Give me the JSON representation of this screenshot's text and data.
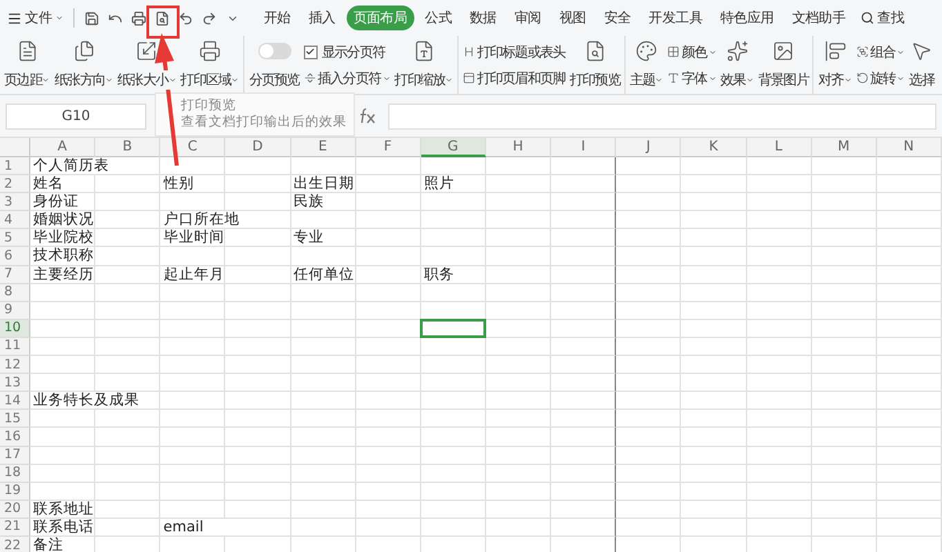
{
  "menu": {
    "file_label": "文件",
    "tabs": [
      {
        "label": "开始",
        "selected": false
      },
      {
        "label": "插入",
        "selected": false
      },
      {
        "label": "页面布局",
        "selected": true
      },
      {
        "label": "公式",
        "selected": false
      },
      {
        "label": "数据",
        "selected": false
      },
      {
        "label": "审阅",
        "selected": false
      },
      {
        "label": "视图",
        "selected": false
      },
      {
        "label": "安全",
        "selected": false
      },
      {
        "label": "开发工具",
        "selected": false
      },
      {
        "label": "特色应用",
        "selected": false
      },
      {
        "label": "文档助手",
        "selected": false
      }
    ],
    "search_label": "查找"
  },
  "ribbon": [
    [
      {
        "kind": "large",
        "label": "页边距",
        "dropdown": true
      },
      {
        "kind": "large",
        "label": "纸张方向",
        "dropdown": true
      },
      {
        "kind": "large",
        "label": "纸张大小",
        "dropdown": true
      },
      {
        "kind": "large",
        "label": "打印区域",
        "dropdown": true
      }
    ],
    [
      {
        "kind": "toggle",
        "label": "分页预览",
        "on": false
      },
      {
        "kind": "stack",
        "items": [
          {
            "kind": "check",
            "label": "显示分页符",
            "checked": true
          },
          {
            "kind": "small",
            "label": "插入分页符",
            "dropdown": true
          }
        ]
      },
      {
        "kind": "large",
        "label": "打印缩放",
        "dropdown": true
      }
    ],
    [
      {
        "kind": "stack",
        "items": [
          {
            "kind": "small",
            "label": "打印标题或表头",
            "dropdown": false
          },
          {
            "kind": "small",
            "label": "打印页眉和页脚",
            "dropdown": false
          }
        ]
      },
      {
        "kind": "large",
        "label": "打印预览",
        "dropdown": false
      }
    ],
    [
      {
        "kind": "large",
        "label": "主题",
        "dropdown": true
      },
      {
        "kind": "stack",
        "items": [
          {
            "kind": "small",
            "label": "颜色",
            "dropdown": true
          },
          {
            "kind": "small",
            "label": "字体",
            "dropdown": true
          }
        ]
      },
      {
        "kind": "large",
        "label": "效果",
        "dropdown": true
      },
      {
        "kind": "large",
        "label": "背景图片",
        "dropdown": false
      }
    ],
    [
      {
        "kind": "large",
        "label": "对齐",
        "dropdown": true
      },
      {
        "kind": "stack",
        "items": [
          {
            "kind": "small",
            "label": "组合",
            "dropdown": true
          },
          {
            "kind": "small",
            "label": "旋转",
            "dropdown": true
          }
        ]
      },
      {
        "kind": "large",
        "label": "选择",
        "dropdown": false
      }
    ]
  ],
  "tooltip": {
    "title": "打印预览",
    "text": "查看文档打印输出后的效果"
  },
  "name_box": "G10",
  "columns": [
    {
      "label": "A",
      "selected": false
    },
    {
      "label": "B",
      "selected": false
    },
    {
      "label": "C",
      "selected": false
    },
    {
      "label": "D",
      "selected": false
    },
    {
      "label": "E",
      "selected": false
    },
    {
      "label": "F",
      "selected": false
    },
    {
      "label": "G",
      "selected": true
    },
    {
      "label": "H",
      "selected": false
    },
    {
      "label": "I",
      "selected": false
    },
    {
      "label": "J",
      "selected": false
    },
    {
      "label": "K",
      "selected": false
    },
    {
      "label": "L",
      "selected": false
    },
    {
      "label": "M",
      "selected": false
    },
    {
      "label": "N",
      "selected": false
    }
  ],
  "rows": [
    {
      "number": "1",
      "selected": false,
      "cells": [
        "个人简历表"
      ]
    },
    {
      "number": "2",
      "selected": false,
      "cells": [
        "姓名",
        null,
        "性别",
        null,
        "出生日期",
        null,
        "照片"
      ]
    },
    {
      "number": "3",
      "selected": false,
      "cells": [
        "身份证",
        null,
        null,
        null,
        "民族"
      ]
    },
    {
      "number": "4",
      "selected": false,
      "cells": [
        "婚姻状况",
        null,
        "户口所在地"
      ]
    },
    {
      "number": "5",
      "selected": false,
      "cells": [
        "毕业院校",
        null,
        "毕业时间",
        null,
        "专业"
      ]
    },
    {
      "number": "6",
      "selected": false,
      "cells": [
        "技术职称"
      ]
    },
    {
      "number": "7",
      "selected": false,
      "cells": [
        "主要经历",
        null,
        "起止年月",
        null,
        "任何单位",
        null,
        "职务"
      ]
    },
    {
      "number": "8",
      "selected": false,
      "cells": []
    },
    {
      "number": "9",
      "selected": false,
      "cells": []
    },
    {
      "number": "10",
      "selected": true,
      "cells": []
    },
    {
      "number": "11",
      "selected": false,
      "cells": []
    },
    {
      "number": "12",
      "selected": false,
      "cells": []
    },
    {
      "number": "13",
      "selected": false,
      "cells": []
    },
    {
      "number": "14",
      "selected": false,
      "cells": [
        "业务特长及成果"
      ]
    },
    {
      "number": "15",
      "selected": false,
      "cells": []
    },
    {
      "number": "16",
      "selected": false,
      "cells": []
    },
    {
      "number": "17",
      "selected": false,
      "cells": []
    },
    {
      "number": "18",
      "selected": false,
      "cells": []
    },
    {
      "number": "19",
      "selected": false,
      "cells": []
    },
    {
      "number": "20",
      "selected": false,
      "cells": [
        "联系地址"
      ]
    },
    {
      "number": "21",
      "selected": false,
      "cells": [
        "联系电话",
        null,
        "email"
      ]
    },
    {
      "number": "22",
      "selected": false,
      "cells": [
        "备注"
      ]
    }
  ]
}
